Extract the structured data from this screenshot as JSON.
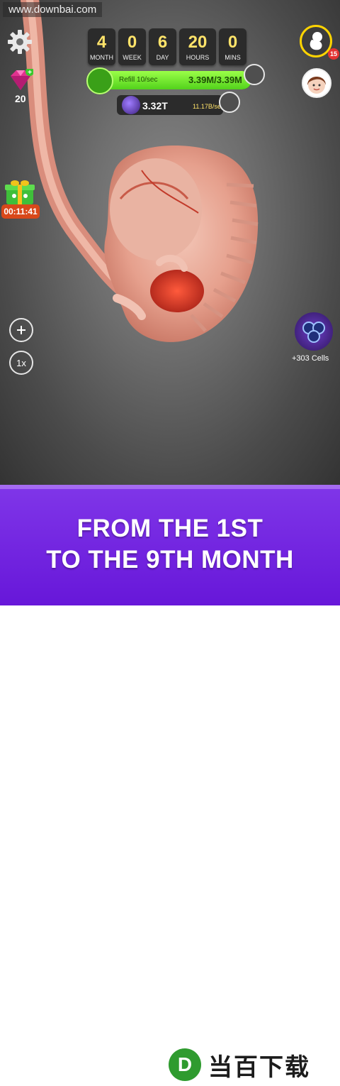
{
  "watermark_top": "www.downbai.com",
  "timer": [
    {
      "value": "4",
      "label": "MONTH"
    },
    {
      "value": "0",
      "label": "WEEK"
    },
    {
      "value": "6",
      "label": "DAY"
    },
    {
      "value": "20",
      "label": "HOURS"
    },
    {
      "value": "0",
      "label": "MINS"
    }
  ],
  "refill": {
    "rate": "Refill 10/sec",
    "value": "3.39M/3.39M",
    "fill_fraction": 1.0
  },
  "cells": {
    "total": "3.32T",
    "rate": "11.17B/sec"
  },
  "gems": {
    "count": "20"
  },
  "gift": {
    "timer": "00:11:41"
  },
  "speed": {
    "label": "1x"
  },
  "pregnancy_badge": "15",
  "cells_reward": {
    "label": "+303 Cells"
  },
  "banner": {
    "line1": "FROM THE 1ST",
    "line2": "TO THE 9TH MONTH"
  },
  "watermark_bottom": {
    "logo": "D",
    "text": "当百下载"
  },
  "colors": {
    "timer_digits": "#ffe36a",
    "refill_green": "#7be63a",
    "banner_purple": "#7127dd",
    "gift_timer": "#d8481a"
  },
  "icons": [
    "gear-icon",
    "gem-icon",
    "gift-icon",
    "plus-icon",
    "speed-icon",
    "pregnancy-icon",
    "avatar",
    "cell-icon",
    "embryo-icon"
  ]
}
